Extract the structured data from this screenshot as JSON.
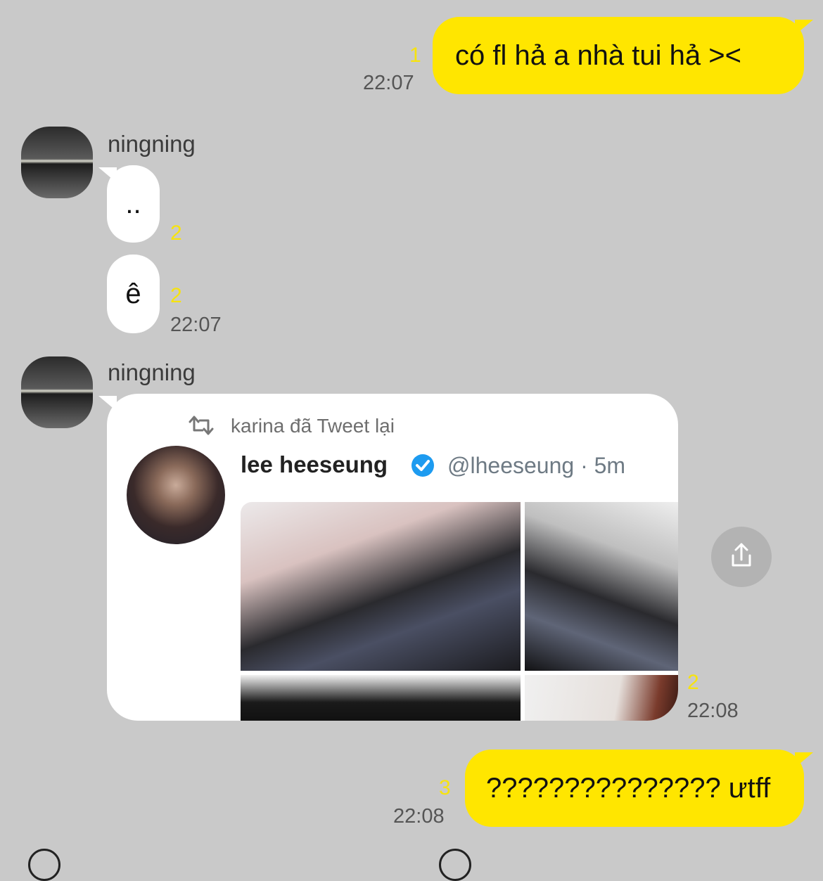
{
  "messages": {
    "m1": {
      "text": "có fl hả a nhà tui hả ><",
      "unread": "1",
      "time": "22:07"
    },
    "m2": {
      "sender": "ningning",
      "text": "..",
      "unread": "2"
    },
    "m3": {
      "text": "ê",
      "unread": "2",
      "time": "22:07"
    },
    "m4": {
      "sender": "ningning",
      "unread": "2",
      "time": "22:08"
    },
    "m5": {
      "text": "??????????????? ưtff",
      "unread": "3",
      "time": "22:08"
    }
  },
  "tweet": {
    "retweet_label": "karina đã Tweet lại",
    "author": "lee heeseung",
    "handle_time": "@lheeseung · 5m"
  },
  "icons": {
    "retweet": "retweet-icon",
    "verified": "verified-badge-icon",
    "share": "share-icon"
  },
  "colors": {
    "background": "#c9c9c9",
    "outgoing_bubble": "#ffe600",
    "incoming_bubble": "#ffffff",
    "unread_count": "#f7e30e",
    "verified": "#1d9bf0"
  }
}
